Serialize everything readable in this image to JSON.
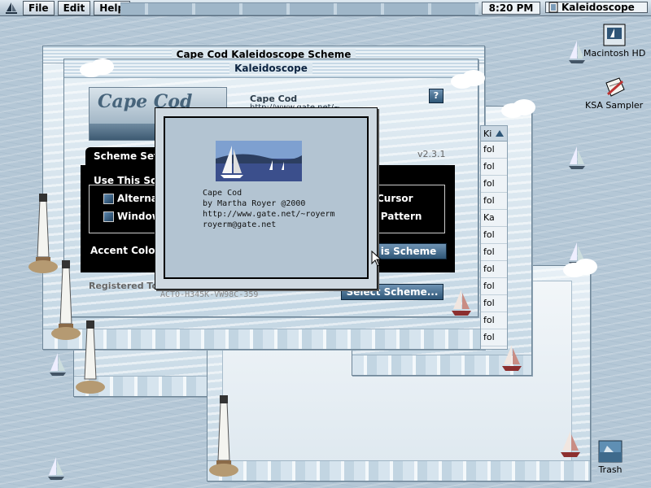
{
  "menubar": {
    "items": [
      "File",
      "Edit",
      "Help"
    ],
    "clock": "8:20 PM",
    "active_app": "Kaleidoscope"
  },
  "desktop_icons": [
    {
      "label": "Macintosh HD",
      "icon": "hard-disk-icon"
    },
    {
      "label": "KSA Sampler",
      "icon": "document-edit-icon"
    },
    {
      "label": "Trash",
      "icon": "trash-icon"
    }
  ],
  "back_window": {
    "title": "Cape Cod Kaleidoscope Scheme"
  },
  "control_panel": {
    "title": "Kaleidoscope",
    "logo_text": "Cape Cod",
    "scheme_url_partial": "http://www.gate.net/~roycrm",
    "tab_label": "Scheme Set",
    "version": "v2.3.1",
    "use_this_scheme_label": "Use This Sch",
    "option_alternate": "Alterna",
    "option_window": "Window",
    "option_cursor": "Cursor",
    "option_pattern": "p Pattern",
    "accent_color_label": "Accent Color",
    "use_scheme_button": "is Scheme",
    "registered_label": "Registered To:",
    "registration_code": "ACTO-H345K-VW98C-359",
    "select_scheme_button": "Select Scheme..."
  },
  "list_column": {
    "header": "Ki",
    "rows": [
      "fol",
      "fol",
      "fol",
      "fol",
      "Ka",
      "fol",
      "fol",
      "fol",
      "fol",
      "fol",
      "fol",
      "fol"
    ]
  },
  "about_dialog": {
    "lines": [
      "Cape Cod",
      "by  Martha Royer @2000",
      "http://www.gate.net/~royerm",
      "royerm@gate.net"
    ]
  },
  "colors": {
    "desktop": "#b4c7d6",
    "panel_black": "#000000",
    "button_blue": "#2e5677"
  }
}
